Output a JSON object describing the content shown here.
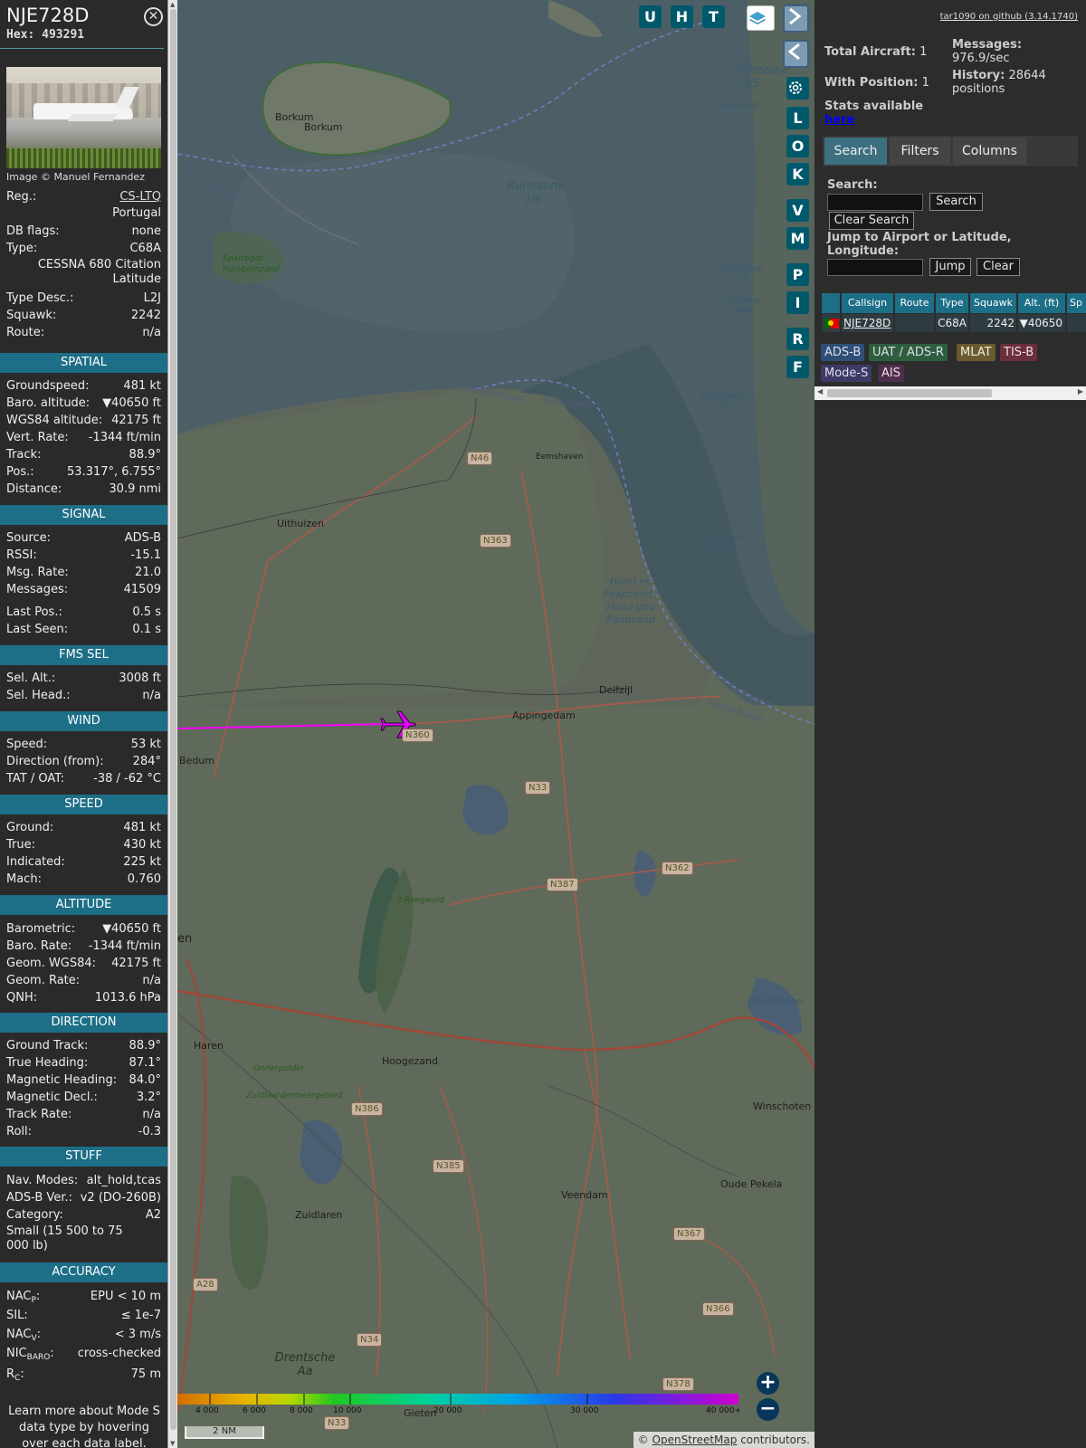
{
  "aircraft": {
    "callsign": "NJE728D",
    "hex_label": "Hex:",
    "hex": "493291",
    "image_credit": "Image © Manuel Fernandez",
    "registration": "CS-LTQ",
    "country": "Portugal",
    "type_name": "CESSNA 680 Citation Latitude",
    "info_rows": [
      {
        "k": "Reg.:",
        "v": "CS-LTQ"
      },
      {
        "k": "DB flags:",
        "v": "none"
      },
      {
        "k": "Type:",
        "v": "C68A"
      },
      {
        "k": "Type Desc.:",
        "v": "L2J"
      },
      {
        "k": "Squawk:",
        "v": "2242"
      },
      {
        "k": "Route:",
        "v": "n/a"
      }
    ]
  },
  "sections": {
    "spatial": {
      "title": "SPATIAL",
      "rows": [
        {
          "k": "Groundspeed:",
          "v": "481 kt"
        },
        {
          "k": "Baro. altitude:",
          "v": "▼40650 ft"
        },
        {
          "k": "WGS84 altitude:",
          "v": "42175 ft"
        },
        {
          "k": "Vert. Rate:",
          "v": "-1344 ft/min"
        },
        {
          "k": "Track:",
          "v": "88.9°"
        },
        {
          "k": "Pos.:",
          "v": "53.317°, 6.755°"
        },
        {
          "k": "Distance:",
          "v": "30.9 nmi"
        }
      ]
    },
    "signal": {
      "title": "SIGNAL",
      "rows": [
        {
          "k": "Source:",
          "v": "ADS-B"
        },
        {
          "k": "RSSI:",
          "v": "-15.1"
        },
        {
          "k": "Msg. Rate:",
          "v": "21.0"
        },
        {
          "k": "Messages:",
          "v": "41509"
        }
      ],
      "rows2": [
        {
          "k": "Last Pos.:",
          "v": "0.5 s"
        },
        {
          "k": "Last Seen:",
          "v": "0.1 s"
        }
      ]
    },
    "fms": {
      "title": "FMS SEL",
      "rows": [
        {
          "k": "Sel. Alt.:",
          "v": "3008 ft"
        },
        {
          "k": "Sel. Head.:",
          "v": "n/a"
        }
      ]
    },
    "wind": {
      "title": "WIND",
      "rows": [
        {
          "k": "Speed:",
          "v": "53 kt"
        },
        {
          "k": "Direction (from):",
          "v": "284°"
        },
        {
          "k": "TAT / OAT:",
          "v": "-38 / -62 °C"
        }
      ]
    },
    "speed": {
      "title": "SPEED",
      "rows": [
        {
          "k": "Ground:",
          "v": "481 kt"
        },
        {
          "k": "True:",
          "v": "430 kt"
        },
        {
          "k": "Indicated:",
          "v": "225 kt"
        },
        {
          "k": "Mach:",
          "v": "0.760"
        }
      ]
    },
    "altitude": {
      "title": "ALTITUDE",
      "rows": [
        {
          "k": "Barometric:",
          "v": "▼40650 ft"
        },
        {
          "k": "Baro. Rate:",
          "v": "-1344 ft/min"
        },
        {
          "k": "Geom. WGS84:",
          "v": "42175 ft"
        },
        {
          "k": "Geom. Rate:",
          "v": "n/a"
        },
        {
          "k": "QNH:",
          "v": "1013.6 hPa"
        }
      ]
    },
    "direction": {
      "title": "DIRECTION",
      "rows": [
        {
          "k": "Ground Track:",
          "v": "88.9°"
        },
        {
          "k": "True Heading:",
          "v": "87.1°"
        },
        {
          "k": "Magnetic Heading:",
          "v": "84.0°"
        },
        {
          "k": "Magnetic Decl.:",
          "v": "3.2°"
        },
        {
          "k": "Track Rate:",
          "v": "n/a"
        },
        {
          "k": "Roll:",
          "v": "-0.3"
        }
      ]
    },
    "stuff": {
      "title": "STUFF",
      "rows": [
        {
          "k": "Nav. Modes:",
          "v": "alt_hold,tcas"
        },
        {
          "k": "ADS-B Ver.:",
          "v": "v2 (DO-260B)"
        },
        {
          "k": "Category:",
          "v": "A2"
        }
      ],
      "category_desc": "Small (15 500 to 75 000 lb)"
    },
    "accuracy": {
      "title": "ACCURACY",
      "nacp_k": "NAC",
      "nacp_sub": "P",
      "nacp_v": "EPU < 10 m",
      "sil_k": "SIL:",
      "sil_v": "≤ 1e-7",
      "nacv_k": "NAC",
      "nacv_sub": "V",
      "nacv_v": "< 3 m/s",
      "nicbaro_k": "NIC",
      "nicbaro_sub": "BARO",
      "nicbaro_v": "cross-checked",
      "rc_k": "R",
      "rc_sub": "C",
      "rc_v": "75 m"
    },
    "footer": "Learn more about Mode S data type by hovering over each data label."
  },
  "map": {
    "buttons_top": [
      "U",
      "H",
      "T"
    ],
    "buttons_side": [
      "L",
      "O",
      "K",
      "V",
      "M",
      "P",
      "I",
      "R",
      "F"
    ],
    "labels": {
      "borkum1": "Borkum",
      "borkum2": "Borkum",
      "uithuizen": "Uithuizen",
      "eemshaven": "Eemshaven",
      "delfzijl": "Delfzijl",
      "appingedam": "Appingedam",
      "bedum": "Bedum",
      "haren": "Haren",
      "hoogezand": "Hoogezand",
      "winschoten": "Winschoten",
      "oudepekela": "Oude Pekela",
      "veendam": "Veendam",
      "zuidlaren": "Zuidlaren",
      "gieten": "Gieten",
      "drentsche": "Drentsche Aa",
      "ruhezone16": "Ruhezone I/6",
      "ruhezone15": "Ruhezone I/5",
      "ruhezone12": "Ruhezone I/2",
      "ruhezone13": "Ruhezone I/3",
      "hondpaapzand": "Hond en Paapzand / Hund und Paapsand",
      "rysumer": "Rysumer Nacken",
      "pilsumer": "Pilsumer Watt",
      "kopersand": "Kopersand",
      "sparregat": "Sparregat Horsbornzand",
      "roegwold": "'t Roegwold",
      "onnerpolder": "Onnerpolder",
      "zuidlaardermeer": "Zuidlaardermeergebied",
      "oldambt": "Oldambtmeer",
      "deutschland1": "Deutschland",
      "nederland1": "Nederland",
      "deutschland2": "Deutschland",
      "nederland2": "Nederland",
      "nedersachsen": "Niedersachsen",
      "en": "en"
    },
    "roads": [
      "N46",
      "N363",
      "N360",
      "N33",
      "N362",
      "N387",
      "N386",
      "N385",
      "N367",
      "N366",
      "N34",
      "N378",
      "A28",
      "N33"
    ],
    "altitude_ticks": [
      "4 000",
      "6 000",
      "8 000",
      "10 000",
      "20 000",
      "30 000",
      "40 000+"
    ],
    "scale": "2 NM",
    "attribution_prefix": "© ",
    "attribution_link": "OpenStreetMap",
    "attribution_suffix": " contributors."
  },
  "right": {
    "github": "tar1090 on github (3.14.1740)",
    "total_aircraft_label": "Total Aircraft:",
    "total_aircraft": "1",
    "with_position_label": "With Position:",
    "with_position": "1",
    "stats_label": "Stats available",
    "stats_link": "here",
    "messages_label": "Messages:",
    "messages": "976.9/sec",
    "history_label": "History:",
    "history": "28644 positions",
    "tabs": [
      "Search",
      "Filters",
      "Columns"
    ],
    "search_label": "Search:",
    "search_btn": "Search",
    "clear_search_btn": "Clear Search",
    "jump_label": "Jump to Airport or Latitude, Longitude:",
    "jump_btn": "Jump",
    "clear_btn": "Clear",
    "table": {
      "headers": [
        "Callsign",
        "Route",
        "Type",
        "Squawk",
        "Alt. (ft)",
        "Sp"
      ],
      "row": {
        "callsign": "NJE728D",
        "route": "",
        "type": "C68A",
        "squawk": "2242",
        "alt": "▼40650"
      }
    },
    "sources": [
      "ADS-B",
      "UAT / ADS-R",
      "MLAT",
      "TIS-B",
      "Mode-S",
      "AIS"
    ]
  }
}
